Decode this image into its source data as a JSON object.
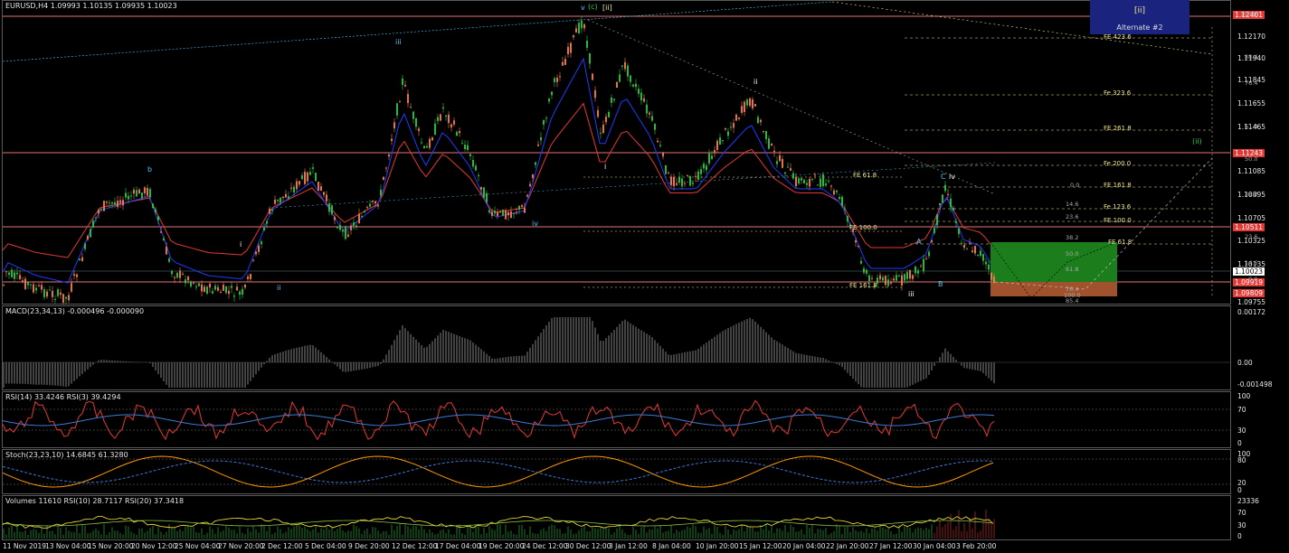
{
  "symbol_header": "EURUSD,H4  1.09993 1.10135 1.09935 1.10023",
  "alt_box": {
    "wave": "[ii]",
    "label": "Alternate #2"
  },
  "indicators": {
    "macd": "MACD(23,34,13) -0.000496 -0.000090",
    "rsi": "RSI(14) 33.4246   RSI(3) 39.4294",
    "stoch": "Stoch(23,23,10) 14.6845 61.3280",
    "volumes": "Volumes 11610   RSI(10) 28.7117   RSI(20) 37.3418"
  },
  "price_axis": [
    "1.12401",
    "1.12170",
    "1.11940",
    "1.11710",
    "1.11480",
    "1.11243",
    "1.11020",
    "1.10790",
    "1.10560",
    "1.10330",
    "1.10100",
    "1.09875"
  ],
  "price_axis_display": [
    "1.12401",
    "1.12170",
    "1.11940",
    "1.11845",
    "1.11655",
    "1.11465",
    "1.11243",
    "1.11085",
    "1.10895",
    "1.10705",
    "1.10511",
    "1.10325",
    "1.10135",
    "1.10023",
    "1.09919",
    "1.09809",
    "1.09755"
  ],
  "price_boxes": {
    "top_red": "1.12401",
    "mid_red": "1.11243",
    "low_red": "1.10511",
    "current": "1.10023",
    "bottom_red1": "1.09919",
    "bottom_red2": "1.09809"
  },
  "macd_axis": [
    "0.00172",
    "0.00",
    "-0.001498"
  ],
  "rsi_axis": [
    "100",
    "70",
    "30",
    "0"
  ],
  "stoch_axis": [
    "100",
    "80",
    "20",
    "0"
  ],
  "vol_axis": [
    "23336",
    "70",
    "30",
    "0"
  ],
  "x_axis": [
    "11 Nov 2019",
    "13 Nov 04:00",
    "15 Nov 20:00",
    "20 Nov 12:00",
    "25 Nov 04:00",
    "27 Nov 20:00",
    "2 Dec 12:00",
    "5 Dec 04:00",
    "9 Dec 20:00",
    "12 Dec 12:00",
    "17 Dec 04:00",
    "19 Dec 20:00",
    "24 Dec 12:00",
    "30 Dec 12:00",
    "3 Jan 12:00",
    "8 Jan 04:00",
    "10 Jan 20:00",
    "15 Jan 12:00",
    "20 Jan 04:00",
    "22 Jan 20:00",
    "27 Jan 12:00",
    "30 Jan 04:00",
    "3 Feb 20:00"
  ],
  "wave_labels": {
    "b": "b",
    "i1": "i",
    "ii1": "ii",
    "iii1": "iii",
    "iv1": "iv",
    "v_c": "v",
    "c_paren": "(c)",
    "ii_bracket": "[ii]",
    "i2": "i",
    "ii2": "ii",
    "c_iv": "C",
    "iv2": "iv",
    "A": "A",
    "B": "B",
    "iii2": "iii",
    "ii_paren": "(ii)"
  },
  "fe_labels": [
    "FE 423.6",
    "Fe 323.6",
    "FE 261.8",
    "Fe 200.0",
    "FE 161.8",
    "Fe 123.6",
    "FE 100.0",
    "FE 61.8",
    "FE 61.8",
    "FE 100.0",
    "FE 161.8"
  ],
  "fib_labels": [
    "0.0",
    "14.6",
    "23.6",
    "38.2",
    "50.0",
    "61.8",
    "76.4",
    "85.4",
    "100.0"
  ],
  "right_fib_labels": [
    "100.0",
    "88.4",
    "76.4",
    "61.8",
    "50.0",
    "38.2",
    "23.6",
    "14.6",
    "0.0"
  ],
  "colors": {
    "bull": "#2ecc40",
    "bear": "#ff7f50",
    "ema_red": "#e53935",
    "ema_blue": "#1e3cff",
    "fe_text": "#f0e68c",
    "box_green": "#1b7d1b",
    "box_brown": "#a0522d",
    "rsi_red": "#e53935",
    "rsi_blue": "#3a7bd5",
    "stoch_orange": "#ff9800",
    "stoch_blue": "#3a7bd5"
  }
}
